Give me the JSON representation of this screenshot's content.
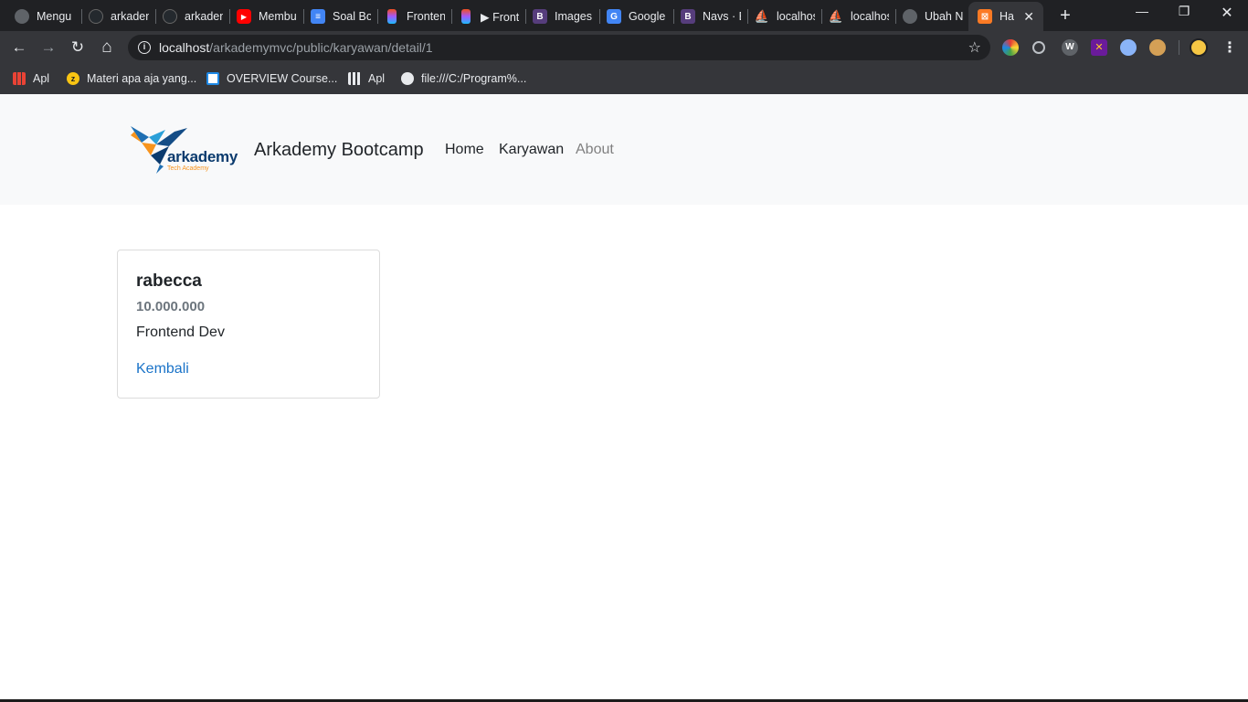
{
  "browser": {
    "tabs": [
      {
        "title": "Mengu",
        "icon": "globe-icon",
        "color": "#5f6368"
      },
      {
        "title": "arkaden",
        "icon": "github-icon",
        "color": "#24292e"
      },
      {
        "title": "arkaden",
        "icon": "github-icon",
        "color": "#24292e"
      },
      {
        "title": "Membu",
        "icon": "youtube-icon",
        "color": "#ff0000"
      },
      {
        "title": "Soal Bo",
        "icon": "docs-icon",
        "color": "#4285f4"
      },
      {
        "title": "Fronten",
        "icon": "figma-icon",
        "color": "#f24e1e"
      },
      {
        "title": "▶ Front",
        "icon": "figma-icon",
        "color": "#f24e1e"
      },
      {
        "title": "Images",
        "icon": "bootstrap-icon",
        "color": "#563d7c"
      },
      {
        "title": "Google",
        "icon": "google-translate-icon",
        "color": "#4285f4"
      },
      {
        "title": "Navs · B",
        "icon": "bootstrap-icon",
        "color": "#563d7c"
      },
      {
        "title": "localhos",
        "icon": "phpmyadmin-icon",
        "color": "#f89c0e"
      },
      {
        "title": "localhos",
        "icon": "phpmyadmin-icon",
        "color": "#f89c0e"
      },
      {
        "title": "Ubah N",
        "icon": "globe-icon",
        "color": "#5f6368"
      }
    ],
    "active_tab": {
      "title": "Hala",
      "icon": "xampp-icon",
      "color": "#fb7a24",
      "close": "✕"
    },
    "new_tab": "+",
    "window_controls": {
      "minimize": "—",
      "restore": "❐",
      "close": "✕"
    },
    "nav": {
      "back": "←",
      "forward": "→",
      "reload": "↻",
      "home": "⌂"
    },
    "url": {
      "host": "localhost",
      "path": "/arkademymvc/public/karyawan/detail/1"
    },
    "star": "☆",
    "bookmarks": [
      {
        "label": "Apl",
        "icon": "apps-grid-icon"
      },
      {
        "label": "Materi apa aja yang...",
        "icon": "z-icon"
      },
      {
        "label": "OVERVIEW Course...",
        "icon": "course-icon"
      },
      {
        "label": "Apl",
        "icon": "apps-grid-icon"
      },
      {
        "label": "file:///C:/Program%...",
        "icon": "globe-icon"
      }
    ]
  },
  "site": {
    "brand": "Arkademy Bootcamp",
    "logo_text": "arkademy",
    "logo_subtext": "Tech Academy",
    "nav": [
      {
        "label": "Home",
        "active": true
      },
      {
        "label": "Karyawan",
        "active": true
      },
      {
        "label": "About",
        "active": false
      }
    ]
  },
  "card": {
    "name": "rabecca",
    "salary": "10.000.000",
    "position": "Frontend Dev",
    "back_link": "Kembali"
  }
}
